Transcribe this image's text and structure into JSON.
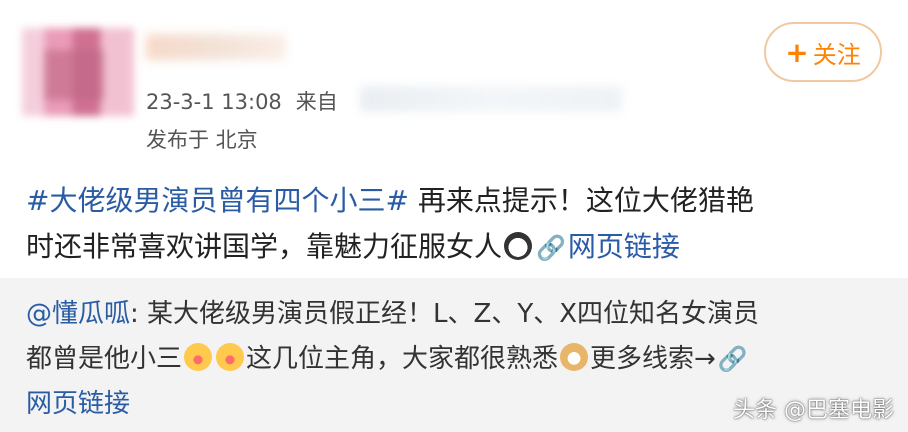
{
  "post": {
    "time_prefix": "23-3-1 13:08",
    "source_prefix": "来自",
    "location": "发布于 北京",
    "follow_label": "关注",
    "hashtag": "#大佬级男演员曾有四个小三#",
    "text_line1": "再来点提示！这位大佬猎艳",
    "text_line2": "时还非常喜欢讲国学，靠魅力征服女人",
    "link_label": "网页链接"
  },
  "repost": {
    "mention": "@懂瓜呱",
    "text_part1": ": 某大佬级男演员假正经！L、Z、Y、X四位知名女演员",
    "text_part2": "都曾是他小三",
    "text_part3": "这几位主角，大家都很熟悉",
    "text_part4": "更多线索→",
    "link_label": "网页链接"
  },
  "watermark": "头条 @巴塞电影",
  "icons": {
    "follow": "plus-icon",
    "link": "link-icon",
    "emoji1": "panda-emoji-icon",
    "emoji2": "yum-emoji-icon",
    "emoji3": "doge-emoji-icon"
  },
  "colors": {
    "link": "#2a5ca6",
    "follow_text": "#ff8200",
    "follow_border": "#f1c9a1",
    "repost_bg": "#f3f3f3"
  }
}
